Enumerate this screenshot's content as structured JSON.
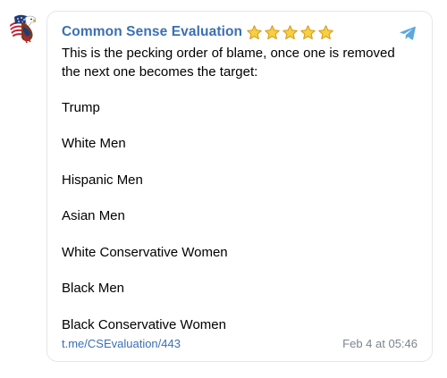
{
  "post": {
    "channel_name": "Common Sense Evaluation",
    "rating_stars": 5,
    "intro_line1": "This is the pecking order of blame, once one is removed",
    "intro_line2": "the next one becomes the target:",
    "items": [
      "Trump",
      "White Men",
      "Hispanic Men",
      "Asian Men",
      "White Conservative Women",
      "Black Men",
      "Black Conservative Women"
    ],
    "link": "t.me/CSEvaluation/443",
    "date": "Feb 4 at 05:46"
  },
  "icons": {
    "avatar": "eagle-flag-avatar-icon",
    "star": "star-icon",
    "share": "telegram-plane-icon"
  },
  "colors": {
    "accent": "#3a70b3",
    "meta": "#7a8591",
    "star_fill": "#f6cf42",
    "star_stroke": "#d79a18",
    "telegram": "#5aa8df"
  }
}
